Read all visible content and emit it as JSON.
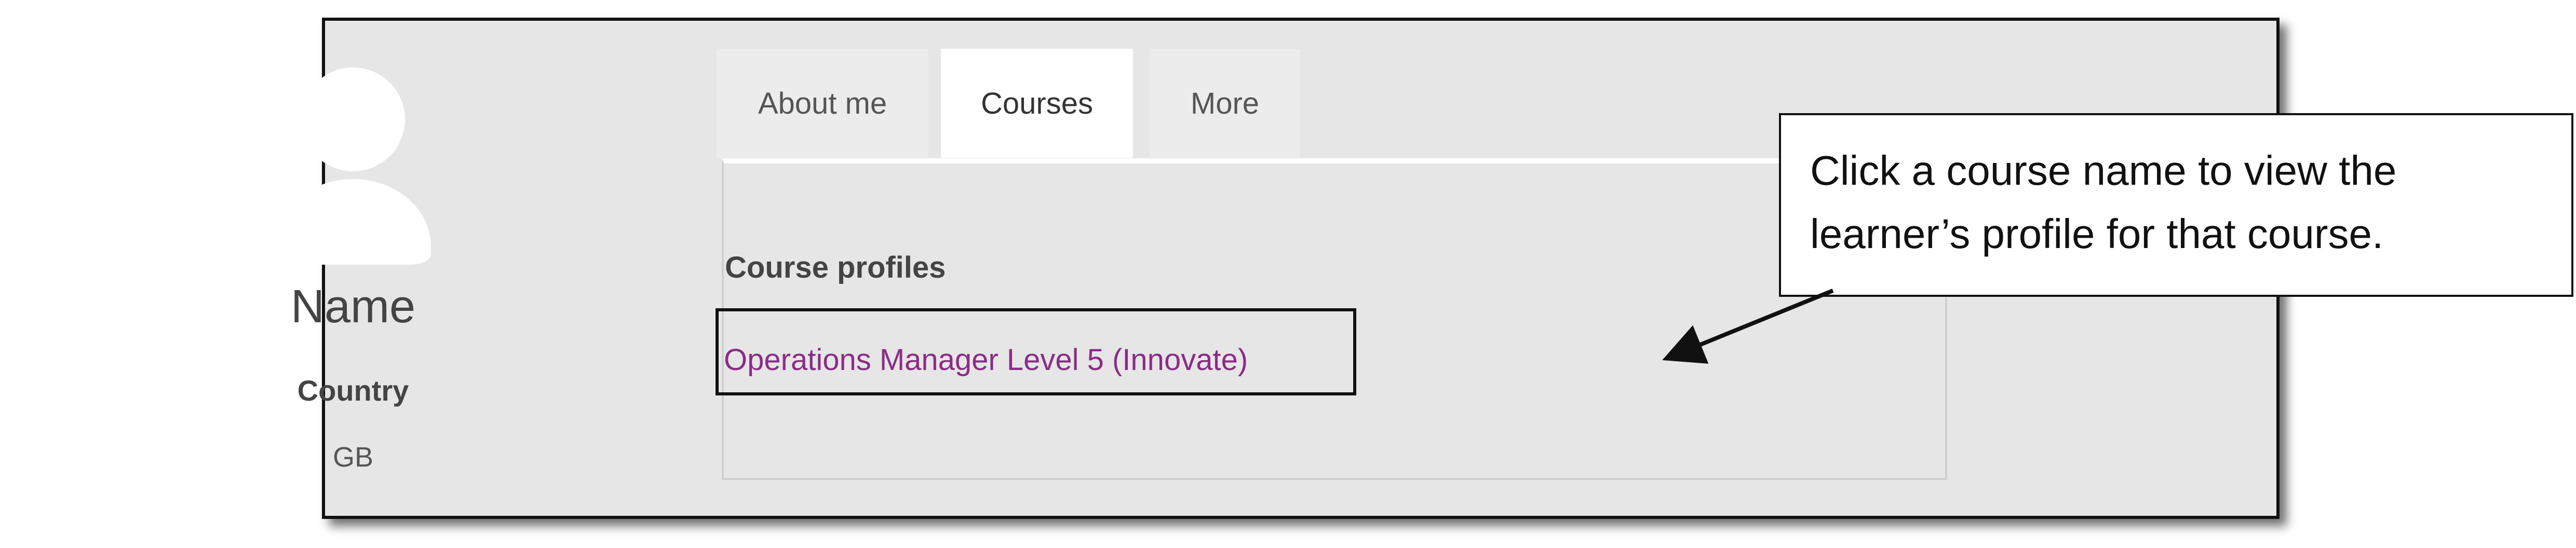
{
  "profile": {
    "name": "Name",
    "country_label": "Country",
    "country_value": "GB"
  },
  "tabs": [
    {
      "label": "About me",
      "active": false
    },
    {
      "label": "Courses",
      "active": true
    },
    {
      "label": "More",
      "active": false
    }
  ],
  "courses": {
    "heading": "Course profiles",
    "items": [
      {
        "label": "Operations Manager Level 5 (Innovate)"
      }
    ]
  },
  "callout": {
    "text": "Click a course name to view the learner’s profile for that course."
  },
  "colors": {
    "panel_background": "#e6e6e6",
    "active_tab": "#ffffff",
    "link": "#8b2c86",
    "border": "#111111"
  },
  "icons": {
    "avatar": "user-avatar-icon",
    "callout_arrow": "arrow-icon"
  }
}
